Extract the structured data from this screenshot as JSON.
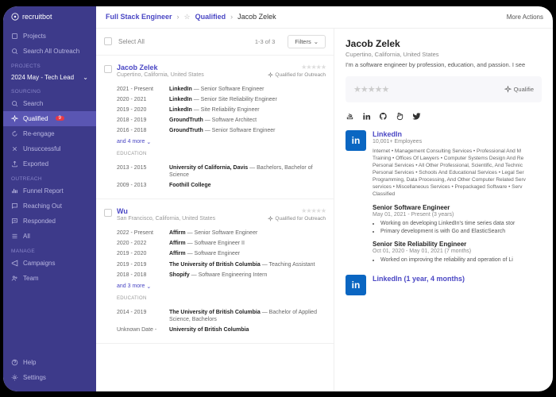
{
  "brand": "recruitbot",
  "sidebar": {
    "top": [
      {
        "label": "Projects"
      },
      {
        "label": "Search All Outreach"
      }
    ],
    "projects_label": "PROJECTS",
    "project": "2024 May - Tech Lead",
    "sourcing_label": "SOURCING",
    "sourcing": [
      {
        "label": "Search"
      },
      {
        "label": "Qualified",
        "badge": "9",
        "active": true
      },
      {
        "label": "Re-engage"
      },
      {
        "label": "Unsuccessful"
      },
      {
        "label": "Exported"
      }
    ],
    "outreach_label": "OUTREACH",
    "outreach": [
      {
        "label": "Funnel Report"
      },
      {
        "label": "Reaching Out"
      },
      {
        "label": "Responded"
      },
      {
        "label": "All"
      }
    ],
    "manage_label": "MANAGE",
    "manage": [
      {
        "label": "Campaigns"
      },
      {
        "label": "Team"
      }
    ],
    "bottom": [
      {
        "label": "Help"
      },
      {
        "label": "Settings"
      }
    ]
  },
  "breadcrumb": {
    "a": "Full Stack Engineer",
    "b": "Qualified",
    "c": "Jacob Zelek"
  },
  "more_actions": "More Actions",
  "list": {
    "select_all": "Select All",
    "count": "1-3 of 3",
    "filters": "Filters",
    "qualified": "Qualified for Outreach",
    "candidates": [
      {
        "name": "Jacob Zelek",
        "location": "Cupertino, California, United States",
        "experience": [
          {
            "dates": "2021 - Present",
            "company": "LinkedIn",
            "title": "Senior Software Engineer"
          },
          {
            "dates": "2020 - 2021",
            "company": "LinkedIn",
            "title": "Senior Site Reliability Engineer"
          },
          {
            "dates": "2019 - 2020",
            "company": "LinkedIn",
            "title": "Site Reliability Engineer"
          },
          {
            "dates": "2018 - 2019",
            "company": "GroundTruth",
            "title": "Software Architect"
          },
          {
            "dates": "2016 - 2018",
            "company": "GroundTruth",
            "title": "Senior Software Engineer"
          }
        ],
        "more": "and 4 more",
        "education": [
          {
            "dates": "2013 - 2015",
            "company": "University of California, Davis",
            "title": "Bachelors, Bachelor of Science"
          },
          {
            "dates": "2009 - 2013",
            "company": "Foothill College",
            "title": ""
          }
        ]
      },
      {
        "name": "Wu",
        "location": "San Francisco, California, United States",
        "experience": [
          {
            "dates": "2022 - Present",
            "company": "Affirm",
            "title": "Senior Software Engineer"
          },
          {
            "dates": "2020 - 2022",
            "company": "Affirm",
            "title": "Software Engineer II"
          },
          {
            "dates": "2019 - 2020",
            "company": "Affirm",
            "title": "Software Engineer"
          },
          {
            "dates": "2019 - 2019",
            "company": "The University of British Columbia",
            "title": "Teaching Assistant"
          },
          {
            "dates": "2018 - 2018",
            "company": "Shopify",
            "title": "Software Engineering Intern"
          }
        ],
        "more": "and 3 more",
        "education": [
          {
            "dates": "2014 - 2019",
            "company": "The University of British Columbia",
            "title": "Bachelor of Applied Science, Bachelors"
          },
          {
            "dates": "Unknown Date -",
            "company": "University of British Columbia",
            "title": ""
          }
        ]
      }
    ]
  },
  "detail": {
    "name": "Jacob Zelek",
    "location": "Cupertino, California, United States",
    "bio": "I'm a software engineer by profession, education, and passion. I see",
    "qualified": "Qualifie",
    "linkedin": {
      "title": "LinkedIn",
      "sub": "10,001+ Employees",
      "desc": "Internet • Management Consulting Services • Professional And M\nTraining • Offices Of Lawyers • Computer Systems Design And Re\nPersonal Services • All Other Professional, Scientific, And Technic\nPersonal Services • Schools And Educational Services • Legal Ser\nProgramming, Data Processing, And Other Computer Related Serv\nservices • Miscellaneous Services • Prepackaged Software • Serv\nClassified"
    },
    "roles": [
      {
        "title": "Senior Software Engineer",
        "dates": "May 01, 2021 - Present (3 years)",
        "bullets": [
          "Working on developing LinkedIn's time series data stor",
          "Primary development is with Go and ElasticSearch"
        ]
      },
      {
        "title": "Senior Site Reliability Engineer",
        "dates": "Oct 01, 2020 - May 01, 2021 (7 months)",
        "bullets": [
          "Worked on improving the reliability and operation of Li"
        ]
      }
    ],
    "footer": "LinkedIn (1 year, 4 months)"
  },
  "labels": {
    "education": "EDUCATION"
  }
}
